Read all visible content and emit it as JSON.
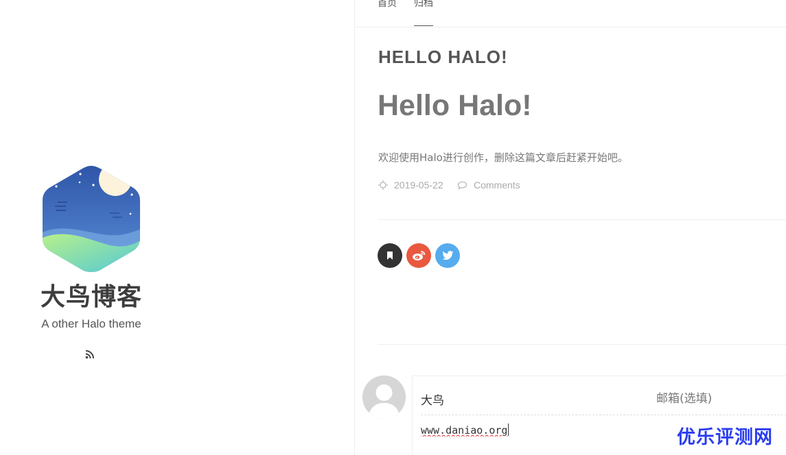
{
  "sidebar": {
    "site_title": "大鸟博客",
    "site_description": "A other Halo theme",
    "rss_icon": "rss-icon",
    "logo_icon": "hexagon-night-landscape-logo"
  },
  "nav": {
    "items": [
      {
        "label": "首页",
        "active": false
      },
      {
        "label": "归档",
        "active": true
      }
    ]
  },
  "post": {
    "heading_caps": "HELLO HALO!",
    "title": "Hello Halo!",
    "excerpt": "欢迎使用Halo进行创作，删除这篇文章后赶紧开始吧。",
    "date": "2019-05-22",
    "comments_label": "Comments"
  },
  "share": {
    "buttons": [
      {
        "icon": "bookmark-icon",
        "color": "#333333"
      },
      {
        "icon": "weibo-icon",
        "color": "#e9583f"
      },
      {
        "icon": "twitter-icon",
        "color": "#55acee"
      }
    ]
  },
  "comment_form": {
    "name_value": "大鸟",
    "email_placeholder": "邮箱(选填)",
    "url_value": "www.daniao.org"
  },
  "watermark": "优乐评测网",
  "colors": {
    "accent_text": "#555555",
    "weibo": "#e9583f",
    "twitter": "#55acee",
    "watermark": "#2a3df0"
  }
}
